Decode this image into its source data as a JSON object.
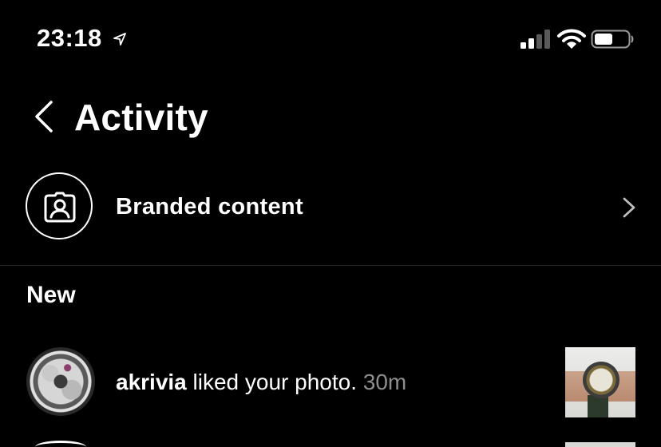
{
  "status_bar": {
    "time": "23:18",
    "icons": [
      "location-arrow-icon",
      "cellular-signal-icon",
      "wifi-icon",
      "battery-icon"
    ]
  },
  "header": {
    "title": "Activity",
    "back_icon": "chevron-left-icon"
  },
  "branded": {
    "label": "Branded content",
    "icon": "branded-content-badge-icon",
    "chevron_icon": "chevron-right-icon"
  },
  "sections": [
    {
      "heading": "New",
      "items": [
        {
          "username": "akrivia",
          "action": " liked your photo. ",
          "time": "30m",
          "avatar": "watch-movement-avatar",
          "thumbnail": "wristwatch-photo-thumbnail"
        }
      ]
    }
  ],
  "colors": {
    "background": "#000000",
    "text": "#ffffff",
    "secondary_text": "#8e8e8e",
    "divider": "#262626"
  }
}
